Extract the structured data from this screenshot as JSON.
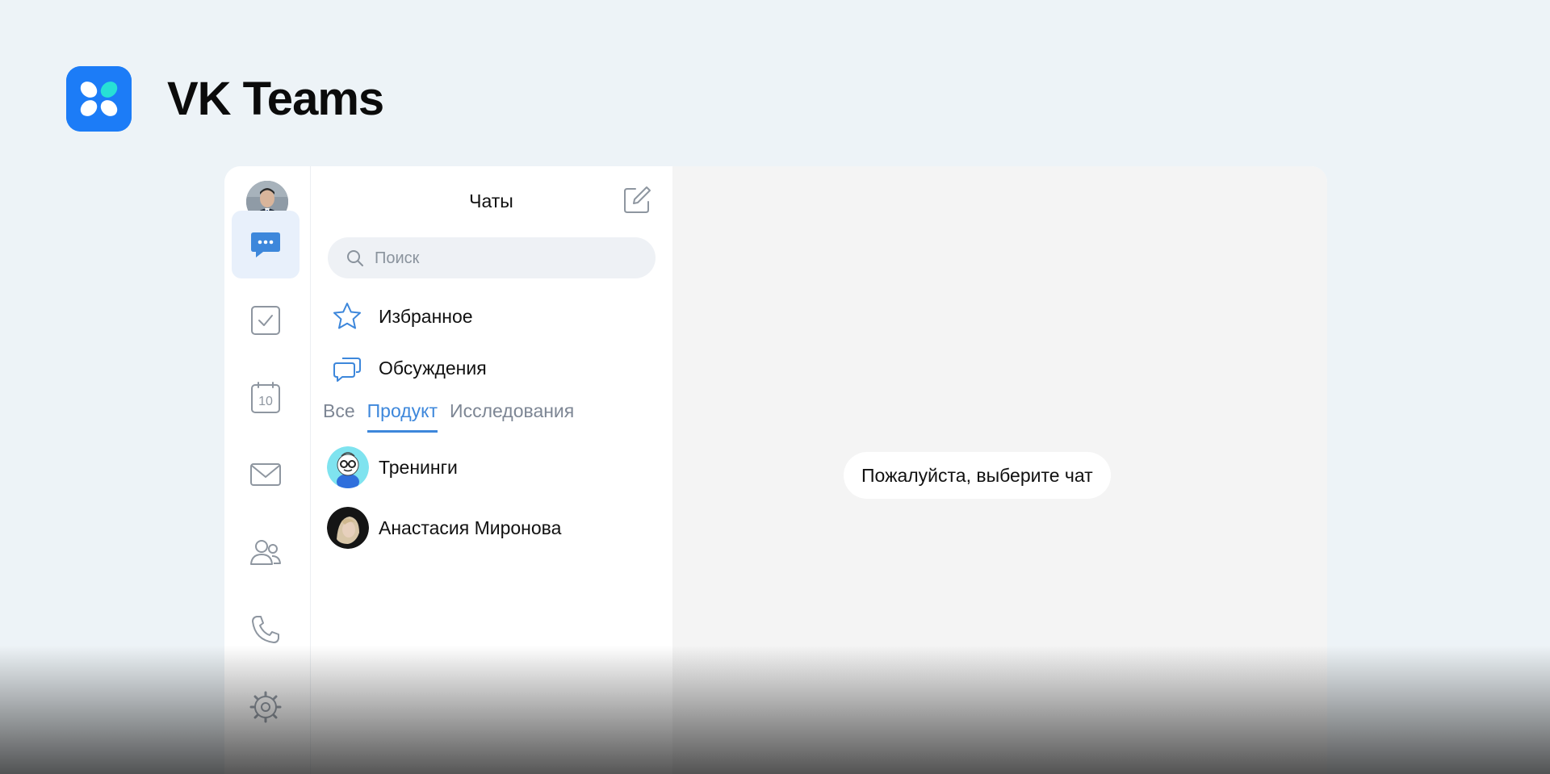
{
  "brand": {
    "name": "VK Teams",
    "logo_icon": "vk-teams-logo-icon",
    "logo_color": "#1c7cf7"
  },
  "rail": {
    "items": [
      {
        "icon": "chat-bubble-icon",
        "active": true
      },
      {
        "icon": "task-checkbox-icon",
        "active": false
      },
      {
        "icon": "calendar-icon",
        "label": "10",
        "active": false
      },
      {
        "icon": "mail-icon",
        "active": false
      },
      {
        "icon": "contacts-icon",
        "active": false
      },
      {
        "icon": "phone-icon",
        "active": false
      },
      {
        "icon": "settings-icon",
        "active": false
      }
    ]
  },
  "chats": {
    "title": "Чаты",
    "search_placeholder": "Поиск",
    "folders": [
      {
        "label": "Избранное",
        "icon": "star-icon"
      },
      {
        "label": "Обсуждения",
        "icon": "discussions-icon"
      }
    ],
    "tabs": [
      {
        "label": "Все",
        "active": false
      },
      {
        "label": "Продукт",
        "active": true
      },
      {
        "label": "Исследования",
        "active": false
      }
    ],
    "items": [
      {
        "name": "Тренинги"
      },
      {
        "name": "Анастасия Миронова"
      }
    ]
  },
  "main": {
    "empty_message": "Пожалуйста, выберите чат"
  },
  "colors": {
    "page_bg": "#edf3f7",
    "accent": "#3d87db",
    "active_rail_bg": "#e8f0fb"
  }
}
